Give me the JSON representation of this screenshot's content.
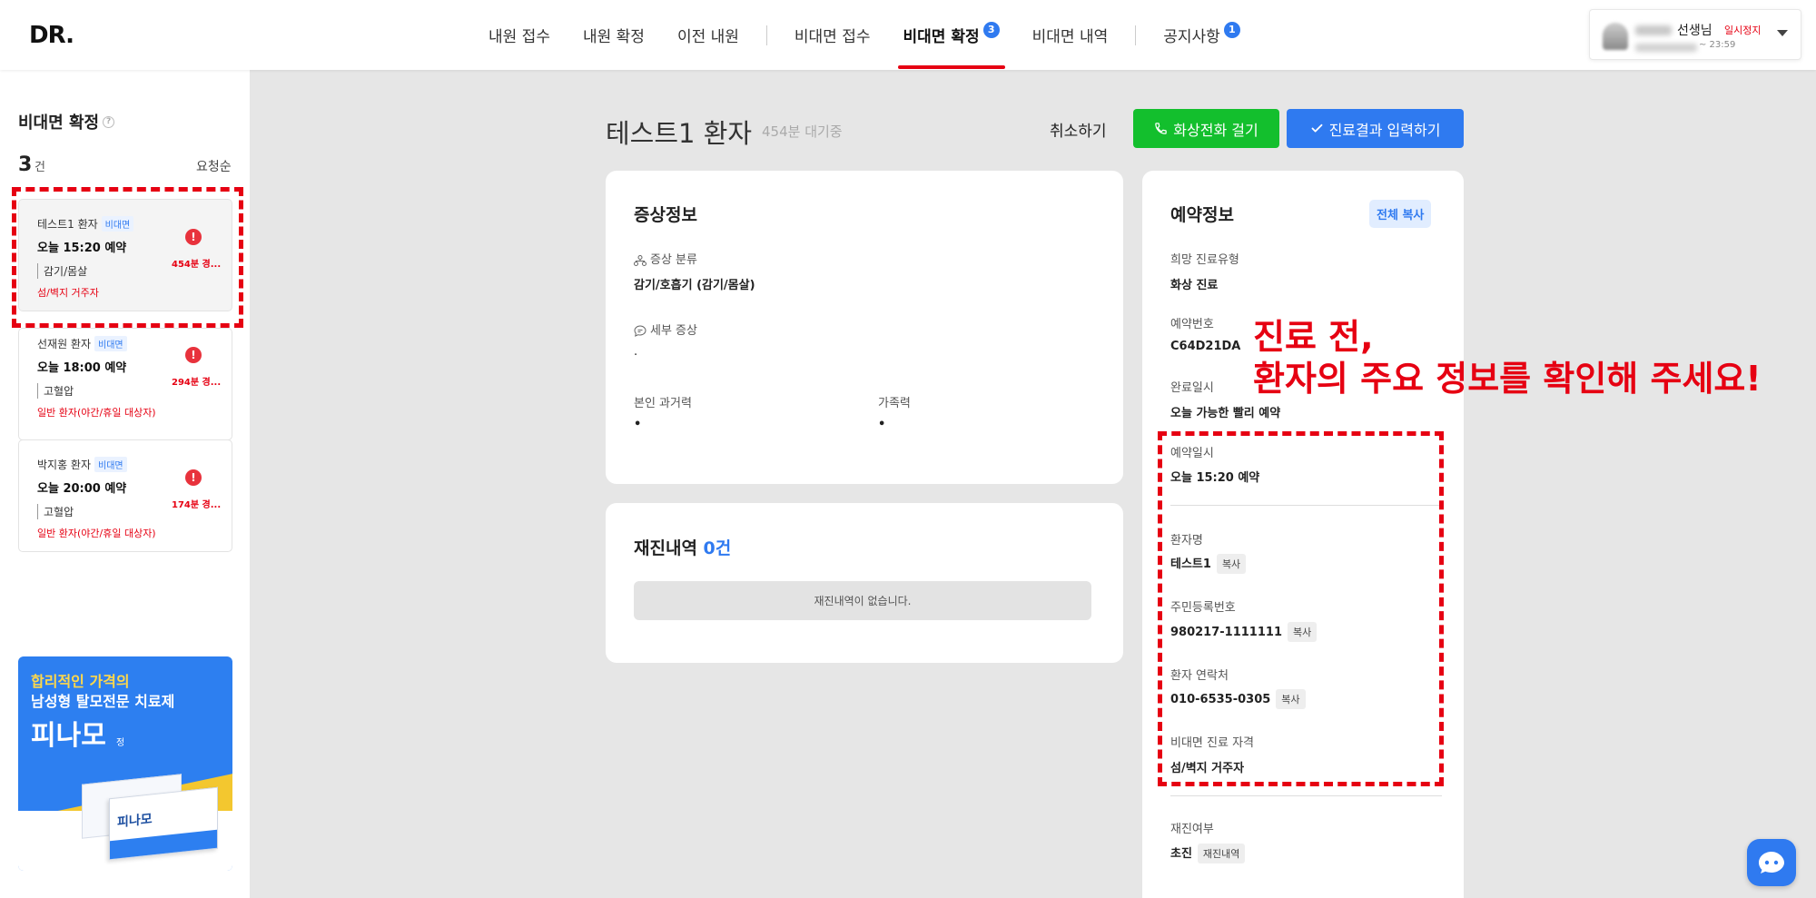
{
  "logo": "DR.",
  "nav": {
    "items": [
      {
        "label": "내원 접수"
      },
      {
        "label": "내원 확정"
      },
      {
        "label": "이전 내원"
      },
      {
        "label": "비대면 접수"
      },
      {
        "label": "비대면 확정",
        "badge": "3",
        "active": true
      },
      {
        "label": "비대면 내역"
      },
      {
        "label": "공지사항",
        "badge": "1"
      }
    ]
  },
  "user": {
    "name": "선생님",
    "status": "일시정지",
    "time": "~ 23:59"
  },
  "sidebar": {
    "title": "비대면 확정",
    "count": "3",
    "count_unit": "건",
    "sort": "요청순",
    "patients": [
      {
        "name": "테스트1 환자",
        "tag": "비대면",
        "time": "오늘 15:20 예약",
        "diagnosis": "감기/몸살",
        "note": "섬/벽지 거주자",
        "wait": "454분 경..."
      },
      {
        "name": "선재원 환자",
        "tag": "비대면",
        "time": "오늘 18:00 예약",
        "diagnosis": "고혈압",
        "note": "일반 환자(야간/휴일 대상자)",
        "wait": "294분 경..."
      },
      {
        "name": "박지홍 환자",
        "tag": "비대면",
        "time": "오늘 20:00 예약",
        "diagnosis": "고혈압",
        "note": "일반 환자(야간/휴일 대상자)",
        "wait": "174분 경..."
      }
    ]
  },
  "ad": {
    "line1": "합리적인 가격의",
    "line2": "남성형 탈모전문 치료제",
    "product": "피나모",
    "product_suffix": "정",
    "box_label": "피나모"
  },
  "header": {
    "patient_title": "테스트1 환자",
    "wait_info": "454분 대기중",
    "cancel_label": "취소하기",
    "video_call_label": "화상전화 걸기",
    "result_label": "진료결과 입력하기"
  },
  "symptoms": {
    "title": "증상정보",
    "category_label": "증상 분류",
    "category_value": "감기/호흡기 (감기/몸살)",
    "detail_label": "세부 증상",
    "detail_value": ".",
    "history_label": "본인 과거력",
    "history_value": "•",
    "family_label": "가족력",
    "family_value": "•"
  },
  "recheck": {
    "title": "재진내역",
    "count": "0건",
    "empty": "재진내역이 없습니다."
  },
  "reservation": {
    "title": "예약정보",
    "copy_all": "전체 복사",
    "copy_label": "복사",
    "fields": {
      "type_label": "희망 진료유형",
      "type_value": "화상 진료",
      "number_label": "예약번호",
      "number_value": "C64D21DA",
      "completed_label": "완료일시",
      "completed_value": "오늘 가능한 빨리 예약",
      "datetime_label": "예약일시",
      "datetime_value": "오늘 15:20 예약",
      "name_label": "환자명",
      "name_value": "테스트1",
      "rrn_label": "주민등록번호",
      "rrn_value": "980217-1111111",
      "phone_label": "환자 연락처",
      "phone_value": "010-6535-0305",
      "eligibility_label": "비대면 진료 자격",
      "eligibility_value": "섬/벽지 거주자",
      "revisit_label": "재진여부",
      "revisit_value": "초진",
      "revisit_link": "재진내역"
    }
  },
  "callout": {
    "line1": "진료 전,",
    "line2": "환자의 주요 정보를 확인해 주세요!"
  },
  "colors": {
    "accent_red": "#e60012",
    "primary_blue": "#2f7af0",
    "call_green": "#13bf2d"
  }
}
